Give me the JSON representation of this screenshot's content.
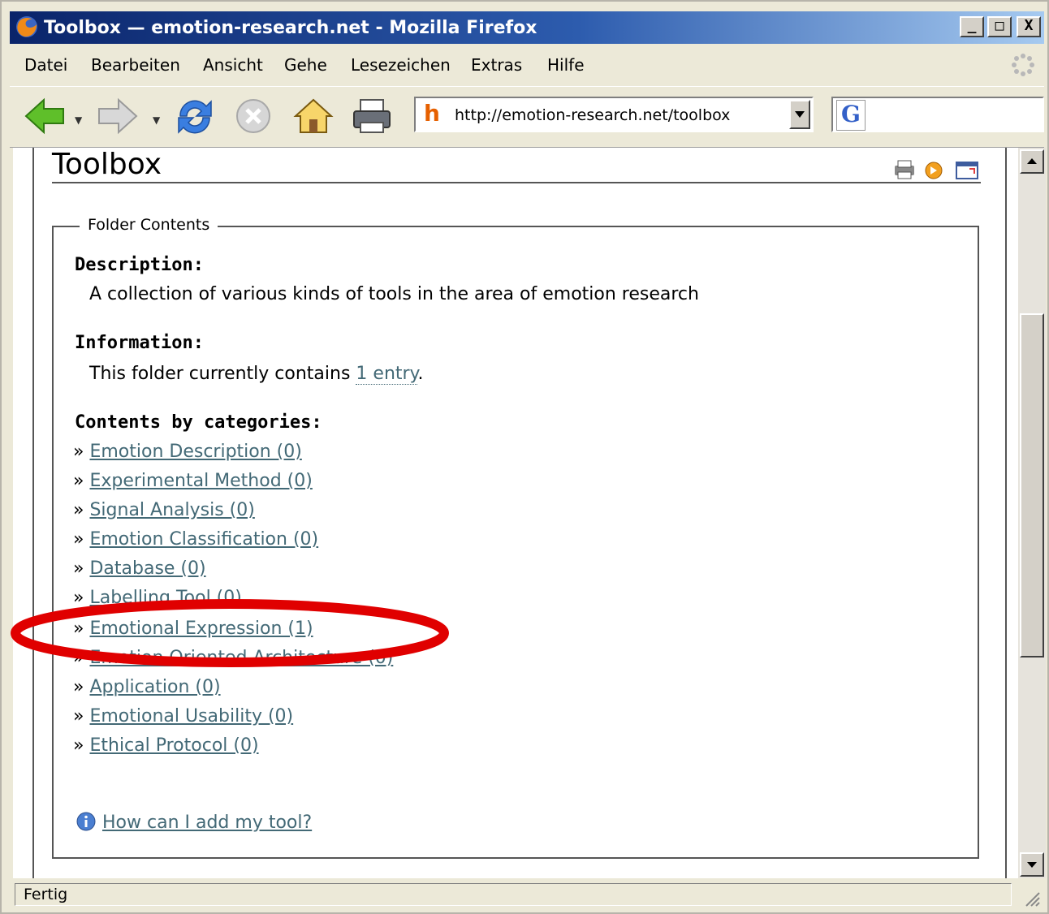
{
  "window": {
    "title": "Toolbox — emotion-research.net - Mozilla Firefox",
    "minimize": "_",
    "maximize": "□",
    "close": "X"
  },
  "menu": {
    "items": [
      {
        "label": "Datei"
      },
      {
        "label": "Bearbeiten"
      },
      {
        "label": "Ansicht"
      },
      {
        "label": "Gehe"
      },
      {
        "label": "Lesezeichen"
      },
      {
        "label": "Extras"
      },
      {
        "label": "Hilfe"
      }
    ]
  },
  "toolbar": {
    "url": "http://emotion-research.net/toolbox",
    "site_icon": "h",
    "search_icon": "G",
    "icons": [
      "back-icon",
      "forward-icon",
      "reload-icon",
      "stop-icon",
      "home-icon",
      "print-icon"
    ]
  },
  "page": {
    "title": "Toolbox",
    "fieldset_legend": "Folder Contents",
    "description_label": "Description:",
    "description_text": "A collection of various kinds of tools in the area of emotion research",
    "information_label": "Information:",
    "information_prefix": "This folder currently contains",
    "information_link": "1 entry",
    "information_suffix": ".",
    "categories_label": "Contents by categories:",
    "bullet": "»",
    "categories": [
      "Emotion Description (0)",
      "Experimental Method (0)",
      "Signal Analysis (0)",
      "Emotion Classification (0)",
      "Database (0)",
      "Labelling Tool (0)",
      "Emotional Expression (1)",
      "Emotion Oriented Architecture (0)",
      "Application (0)",
      "Emotional Usability (0)",
      "Ethical Protocol (0)"
    ],
    "howto_link": "How can I add my tool?",
    "highlight_color": "#e00000",
    "link_color": "#436976"
  },
  "status": {
    "text": "Fertig"
  }
}
